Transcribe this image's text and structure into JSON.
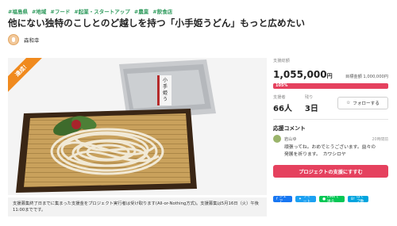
{
  "tags": [
    "#福島県",
    "#地域",
    "#フード",
    "#起業・スタートアップ",
    "#農業",
    "#飲食店"
  ],
  "title": "他にない独特のこしとのど越しを持つ「小手姫うどん」もっと広めたい",
  "owner": {
    "name": "森和幸"
  },
  "hero": {
    "ribbon": "達成！",
    "package_text": "小手姫うどん",
    "caption": "支援募集終了日までに集まった支援金をプロジェクト実行者は受け取ります(All-or-Nothing方式)。支援募集は5月16日（火）午後11:00までです。"
  },
  "stats": {
    "total_label": "支援総額",
    "amount": "1,055,000",
    "amount_unit": "円",
    "goal": "目標金額 1,000,000円",
    "progress_label": "105%",
    "progress_fraction": 1.0,
    "supporters_label": "支援者",
    "supporters_value": "66人",
    "remaining_label": "残り",
    "remaining_value": "3日",
    "follow_label": "フォローする",
    "follow_icon": "star-icon"
  },
  "cheer": {
    "title": "応援コメント",
    "comment": {
      "name": "岩山ゆ",
      "time": "20時間前",
      "body_line1": "頑張ってね。おめでとうございます。益々の",
      "body_line2": "発展を祈ります。　カワシロヤ"
    }
  },
  "support_button": "プロジェクトの支援にすすむ",
  "shares": {
    "facebook": "シェア",
    "twitter": "ツイート",
    "line": "LINEで送る",
    "hatena": "はてブ数"
  },
  "colors": {
    "accent": "#e5415e",
    "tag": "#2e9a5c",
    "ribbon": "#f08a1e"
  }
}
